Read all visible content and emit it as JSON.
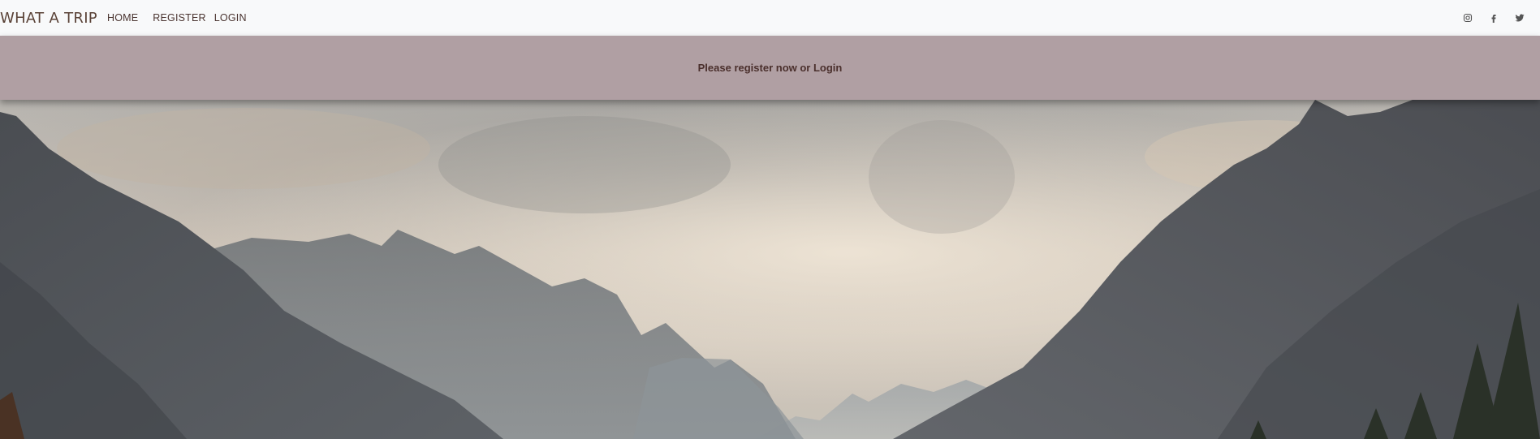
{
  "navbar": {
    "brand": "WHAT A TRIP",
    "links": [
      {
        "label": "HOME"
      },
      {
        "label": "REGISTER"
      },
      {
        "label": "LOGIN"
      }
    ],
    "social_icons": [
      "instagram-icon",
      "facebook-icon",
      "twitter-icon"
    ]
  },
  "notice": {
    "text": "Please register now or Login"
  },
  "hero": {
    "image": "mountain-valley-landscape"
  },
  "colors": {
    "navbar_bg": "#f8f9fa",
    "brand": "#5a4237",
    "notice_bg": "#b09fa3",
    "notice_text": "#4a2f2c"
  }
}
